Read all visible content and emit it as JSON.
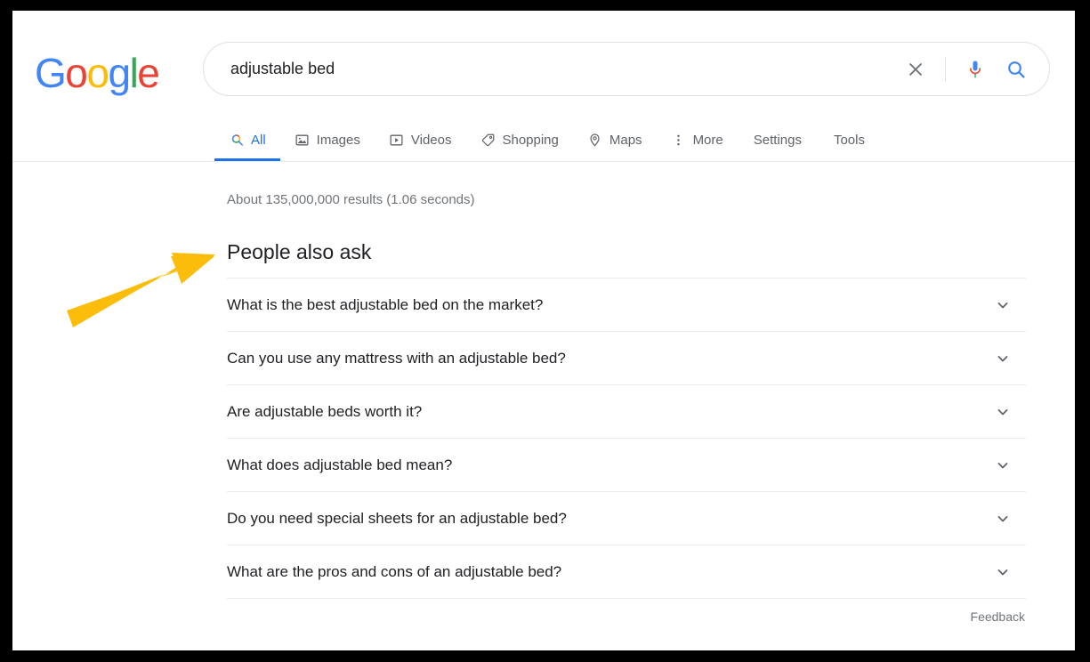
{
  "brand": {
    "logo_text": "Google",
    "logo_colors": [
      "#4285f4",
      "#ea4335",
      "#fbbc05",
      "#4285f4",
      "#34a853",
      "#ea4335"
    ],
    "letters": [
      "G",
      "o",
      "o",
      "g",
      "l",
      "e"
    ],
    "accent_blue": "#1a73e8"
  },
  "search": {
    "value": "adjustable bed",
    "placeholder": "Search",
    "clear_icon": "close-icon",
    "mic_icon": "microphone-icon",
    "submit_icon": "search-icon"
  },
  "nav": {
    "tabs": [
      {
        "label": "All",
        "icon": "search-icon",
        "active": true
      },
      {
        "label": "Images",
        "icon": "image-icon",
        "active": false
      },
      {
        "label": "Videos",
        "icon": "video-play-icon",
        "active": false
      },
      {
        "label": "Shopping",
        "icon": "price-tag-icon",
        "active": false
      },
      {
        "label": "Maps",
        "icon": "map-pin-icon",
        "active": false
      },
      {
        "label": "More",
        "icon": "kebab-menu-icon",
        "active": false
      }
    ],
    "right_items": [
      {
        "label": "Settings"
      },
      {
        "label": "Tools"
      }
    ]
  },
  "results": {
    "stats": "About 135,000,000 results (1.06 seconds)"
  },
  "people_also_ask": {
    "title": "People also ask",
    "questions": [
      {
        "text": "What is the best adjustable bed on the market?",
        "icon": "chevron-down-icon"
      },
      {
        "text": "Can you use any mattress with an adjustable bed?",
        "icon": "chevron-down-icon"
      },
      {
        "text": "Are adjustable beds worth it?",
        "icon": "chevron-down-icon"
      },
      {
        "text": "What does adjustable bed mean?",
        "icon": "chevron-down-icon"
      },
      {
        "text": "Do you need special sheets for an adjustable bed?",
        "icon": "chevron-down-icon"
      },
      {
        "text": "What are the pros and cons of an adjustable bed?",
        "icon": "chevron-down-icon"
      }
    ],
    "feedback_label": "Feedback"
  },
  "annotation": {
    "arrow_color": "#fbbc0a",
    "arrow_name": "highlight-arrow"
  }
}
